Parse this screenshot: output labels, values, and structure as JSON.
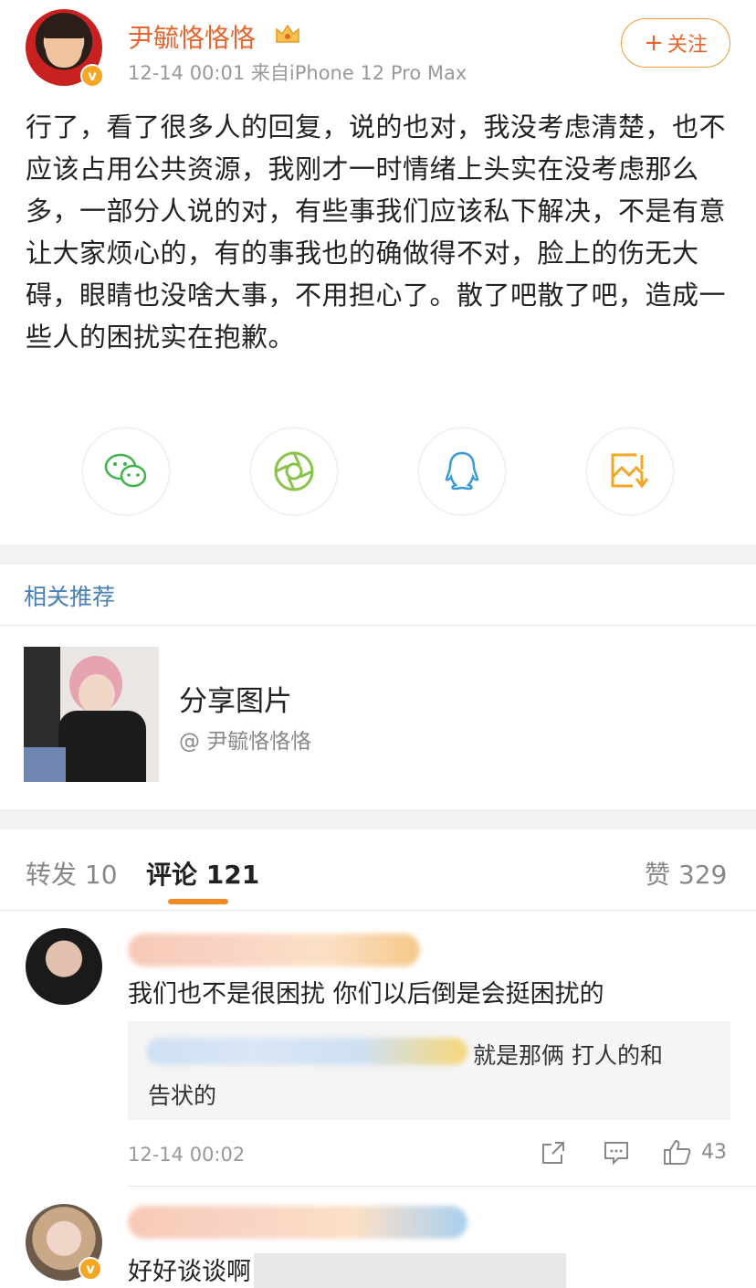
{
  "post": {
    "username": "尹毓恪恪恪",
    "meta": "12-14 00:01  来自iPhone 12 Pro Max",
    "follow_label": "关注",
    "follow_plus": "+",
    "badge": "v",
    "body": "行了，看了很多人的回复，说的也对，我没考虑清楚，也不应该占用公共资源，我刚才一时情绪上头实在没考虑那么多，一部分人说的对，有些事我们应该私下解决，不是有意让大家烦心的，有的事我也的确做得不对，脸上的伤无大碍，眼睛也没啥大事，不用担心了。散了吧散了吧，造成一些人的困扰实在抱歉。"
  },
  "share": {
    "items": [
      {
        "icon": "wechat-icon",
        "color": "#3cb34a"
      },
      {
        "icon": "moments-icon",
        "color": "#8bc34a"
      },
      {
        "icon": "qq-icon",
        "color": "#3a9ad9"
      },
      {
        "icon": "save-image-icon",
        "color": "#f5a623"
      }
    ]
  },
  "related": {
    "title": "相关推荐",
    "card": {
      "title": "分享图片",
      "author": "@ 尹毓恪恪恪"
    }
  },
  "tabs": {
    "repost": "转发 10",
    "comments": "评论 121",
    "likes": "赞 329"
  },
  "comments": [
    {
      "text": "我们也不是很困扰 你们以后倒是会挺困扰的",
      "reply_line1": "就是那俩 打人的和",
      "reply_line2": "告状的",
      "time": "12-14 00:02",
      "like_count": "43"
    },
    {
      "text": "好好谈谈啊"
    }
  ],
  "colors": {
    "accent_orange": "#e8642c",
    "link_blue": "#4a7fb5",
    "verified_gold": "#f5a623"
  }
}
